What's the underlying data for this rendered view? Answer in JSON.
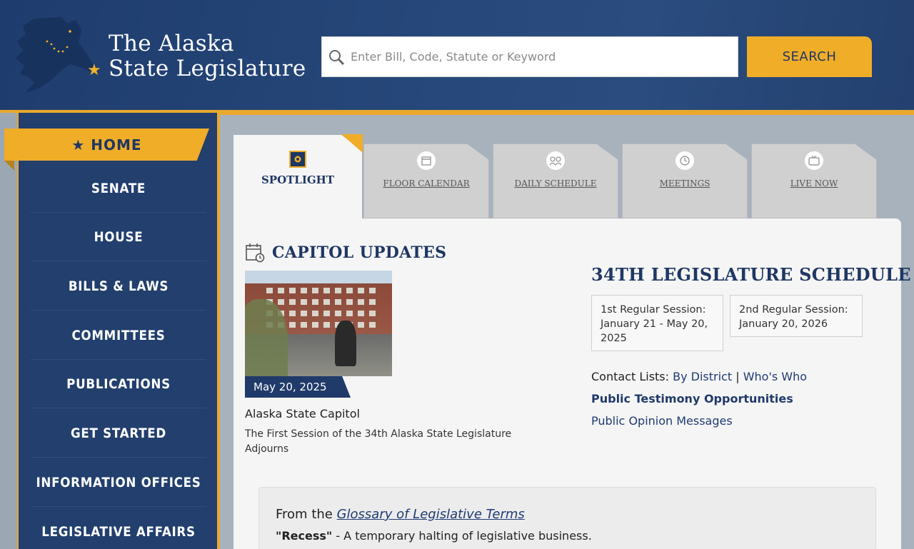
{
  "header": {
    "logo_line1": "The Alaska",
    "logo_line2": "State Legislature",
    "search_placeholder": "Enter Bill, Code, Statute or Keyword",
    "search_button": "SEARCH"
  },
  "sidebar": {
    "home": "★ HOME",
    "items": [
      "SENATE",
      "HOUSE",
      "BILLS & LAWS",
      "COMMITTEES",
      "PUBLICATIONS",
      "GET STARTED",
      "INFORMATION OFFICES",
      "LEGISLATIVE AFFAIRS"
    ]
  },
  "tabs": {
    "active": "SPOTLIGHT",
    "items": [
      "FLOOR CALENDAR",
      "DAILY SCHEDULE",
      "MEETINGS",
      "LIVE NOW"
    ]
  },
  "updates": {
    "heading": "CAPITOL UPDATES",
    "date": "May 20, 2025",
    "title": "Alaska State Capitol",
    "description": "The First Session of the 34th Alaska State Legislature Adjourns"
  },
  "schedule": {
    "heading": "34TH LEGISLATURE SCHEDULE",
    "session1_label": "1st Regular Session:",
    "session1_dates": "January 21 - May 20, 2025",
    "session2_label": "2nd Regular Session:",
    "session2_dates": "January 20, 2026",
    "contact_label": "Contact Lists:",
    "contact_link1": "By District",
    "contact_sep": "|",
    "contact_link2": "Who's Who",
    "testimony": "Public Testimony Opportunities",
    "opinion": "Public Opinion Messages"
  },
  "glossary": {
    "prefix": "From the",
    "link": "Glossary of Legislative Terms",
    "term": "\"Recess\"",
    "definition": " - A temporary halting of legislative business."
  },
  "colors": {
    "navy": "#1f3763",
    "gold": "#f0ad28"
  }
}
